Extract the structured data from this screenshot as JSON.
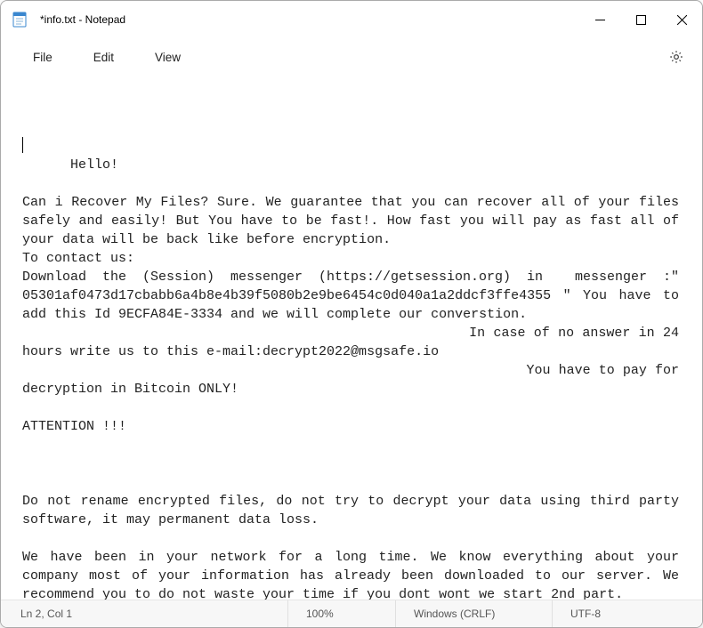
{
  "window": {
    "title": "*info.txt - Notepad"
  },
  "menu": {
    "file": "File",
    "edit": "Edit",
    "view": "View"
  },
  "content": "Hello!\n\nCan i Recover My Files? Sure. We guarantee that you can recover all of your files safely and easily! But You have to be fast!. How fast you will pay as fast all of your data will be back like before encryption.\nTo contact us:\nDownload the (Session) messenger (https://getsession.org) in  messenger :\" 05301af0473d17cbabb6a4b8e4b39f5080b2e9be6454c0d040a1a2ddcf3ffe4355 \" You have to add this Id 9ECFA84E-3334 and we will complete our converstion.\n                                                      In case of no answer in 24 hours write us to this e-mail:decrypt2022@msgsafe.io\n                                                              You have to pay for decryption in Bitcoin ONLY!\n\nATTENTION !!!\n\n\n\nDo not rename encrypted files, do not try to decrypt your data using third party software, it may permanent data loss.\n\nWe have been in your network for a long time. We know everything about your company most of your information has already been downloaded to our server. We recommend you to do not waste your time if you dont wont we start 2nd part.",
  "statusbar": {
    "position": "Ln 2, Col 1",
    "zoom": "100%",
    "line_ending": "Windows (CRLF)",
    "encoding": "UTF-8"
  }
}
